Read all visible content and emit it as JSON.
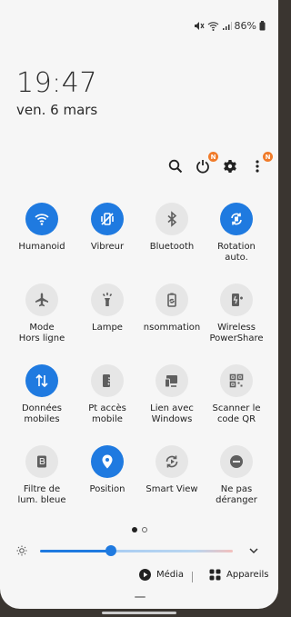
{
  "status_bar": {
    "battery": "86%"
  },
  "lock": {
    "time": "19:47",
    "date": "ven. 6 mars"
  },
  "top_actions": {
    "badge_power": "N",
    "badge_more": "N"
  },
  "tiles": [
    {
      "label": "Humanoid",
      "on": true,
      "icon": "wifi-icon"
    },
    {
      "label": "Vibreur",
      "on": true,
      "icon": "vibrate-icon"
    },
    {
      "label": "Bluetooth",
      "on": false,
      "icon": "bluetooth-icon"
    },
    {
      "label": "Rotation\nauto.",
      "on": true,
      "icon": "rotate-icon"
    },
    {
      "label": "Mode\nHors ligne",
      "on": false,
      "icon": "airplane-icon"
    },
    {
      "label": "Lampe",
      "on": false,
      "icon": "flashlight-icon"
    },
    {
      "label": "nsommation",
      "on": false,
      "icon": "power-saving-icon"
    },
    {
      "label": "Wireless\nPowerShare",
      "on": false,
      "icon": "wireless-powershare-icon"
    },
    {
      "label": "Données\nmobiles",
      "on": true,
      "icon": "mobile-data-icon"
    },
    {
      "label": "Pt accès\nmobile",
      "on": false,
      "icon": "hotspot-icon"
    },
    {
      "label": "Lien avec\nWindows",
      "on": false,
      "icon": "link-windows-icon"
    },
    {
      "label": "Scanner le\ncode QR",
      "on": false,
      "icon": "qr-scanner-icon"
    },
    {
      "label": "Filtre de\nlum. bleue",
      "on": false,
      "icon": "blue-light-filter-icon"
    },
    {
      "label": "Position",
      "on": true,
      "icon": "location-icon"
    },
    {
      "label": "Smart View",
      "on": false,
      "icon": "smart-view-icon"
    },
    {
      "label": "Ne pas\ndéranger",
      "on": false,
      "icon": "do-not-disturb-icon"
    }
  ],
  "brightness": {
    "level": 0.37
  },
  "media": {
    "media_label": "Média",
    "devices_label": "Appareils"
  },
  "colors": {
    "accent": "#1f7ae0",
    "tile_off": "#e6e6e6",
    "badge": "#f07b2a",
    "panel": "#f6f6f6"
  }
}
